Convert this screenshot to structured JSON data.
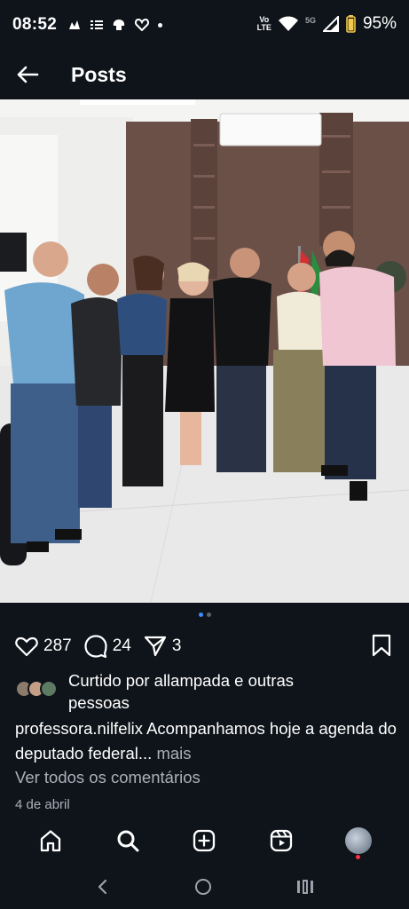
{
  "status_bar": {
    "time": "08:52",
    "left_icons": [
      "notification-icon",
      "message-icon",
      "settings-icon",
      "heart-icon"
    ],
    "network_label_top": "Vo",
    "network_label_bottom": "LTE",
    "wifi_label": "5G",
    "battery": "95%"
  },
  "header": {
    "title": "Posts"
  },
  "post": {
    "like_count": "287",
    "comment_count": "24",
    "share_count": "3",
    "liked_by": "Curtido por allampada e outras pessoas",
    "caption_user": "professora.nilfelix",
    "caption_text": "Acompanhamos hoje a agenda do deputado federal...",
    "caption_more": "mais",
    "comments_link": "Ver todos os comentários",
    "date": "4 de abril",
    "carousel_count": 2,
    "carousel_active": 1
  },
  "bottom_nav": [
    "home-icon",
    "search-icon",
    "create-icon",
    "reels-icon",
    "profile-avatar"
  ],
  "system_nav": [
    "back-icon",
    "home-circle-icon",
    "recents-icon"
  ]
}
